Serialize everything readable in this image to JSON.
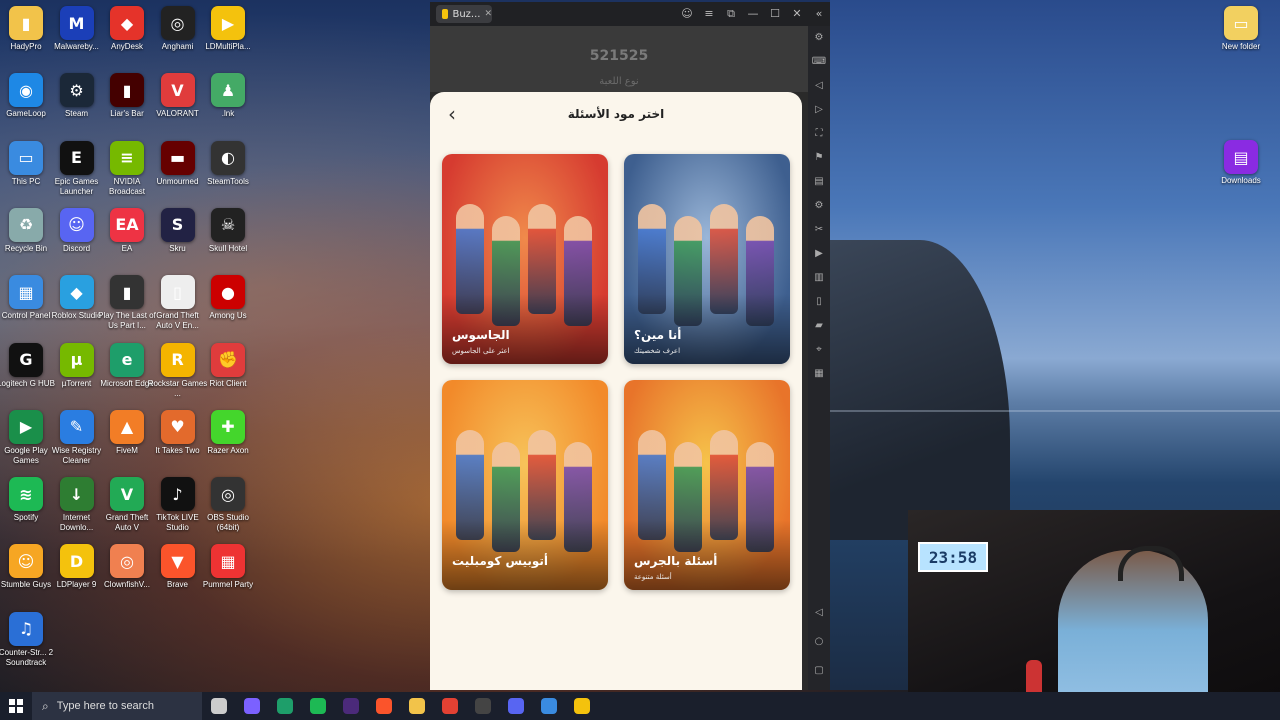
{
  "desktop": {
    "icons": [
      {
        "label": "HadyPro",
        "color": "#f2c34a",
        "glyph": "▮"
      },
      {
        "label": "Malwareby...",
        "color": "#1b3fb8",
        "glyph": "M"
      },
      {
        "label": "AnyDesk",
        "color": "#e5332a",
        "glyph": "◆"
      },
      {
        "label": "Anghami",
        "color": "#222",
        "glyph": "◎"
      },
      {
        "label": "LDMultiPla...",
        "color": "#f4c20d",
        "glyph": "▶"
      },
      {
        "label": "GameLoop",
        "color": "#1e88e5",
        "glyph": "◉"
      },
      {
        "label": "Steam",
        "color": "#1b2838",
        "glyph": "⚙"
      },
      {
        "label": "Liar's Bar",
        "color": "#400",
        "glyph": "▮"
      },
      {
        "label": "VALORANT",
        "color": "#e03c3c",
        "glyph": "V"
      },
      {
        "label": ".lnk",
        "color": "#4a6",
        "glyph": "♟"
      },
      {
        "label": "This PC",
        "color": "#3a8be0",
        "glyph": "▭"
      },
      {
        "label": "Epic Games Launcher",
        "color": "#111",
        "glyph": "E"
      },
      {
        "label": "NVIDIA Broadcast",
        "color": "#76b900",
        "glyph": "≡"
      },
      {
        "label": "Unmourned",
        "color": "#600",
        "glyph": "▬"
      },
      {
        "label": "SteamTools",
        "color": "#333",
        "glyph": "◐"
      },
      {
        "label": "Recycle Bin",
        "color": "#8aa",
        "glyph": "♻"
      },
      {
        "label": "Discord",
        "color": "#5865f2",
        "glyph": "☺"
      },
      {
        "label": "EA",
        "color": "#e34",
        "glyph": "EA"
      },
      {
        "label": "Skru",
        "color": "#224",
        "glyph": "S"
      },
      {
        "label": "Skull Hotel",
        "color": "#222",
        "glyph": "☠"
      },
      {
        "label": "Control Panel",
        "color": "#3a8be0",
        "glyph": "▦"
      },
      {
        "label": "Roblox Studio",
        "color": "#29a0e0",
        "glyph": "◆"
      },
      {
        "label": "Play The Last of Us Part I...",
        "color": "#333",
        "glyph": "▮"
      },
      {
        "label": "Grand Theft Auto V En...",
        "color": "#eee",
        "glyph": "▯"
      },
      {
        "label": "Among Us",
        "color": "#c00",
        "glyph": "●"
      },
      {
        "label": "Logitech G HUB",
        "color": "#111",
        "glyph": "G"
      },
      {
        "label": "µTorrent",
        "color": "#76b900",
        "glyph": "µ"
      },
      {
        "label": "Microsoft Edge",
        "color": "#1e9e6a",
        "glyph": "e"
      },
      {
        "label": "Rockstar Games ...",
        "color": "#f4b400",
        "glyph": "R"
      },
      {
        "label": "Riot Client",
        "color": "#e03c3c",
        "glyph": "✊"
      },
      {
        "label": "Google Play Games",
        "color": "#1a8f4a",
        "glyph": "▶"
      },
      {
        "label": "Wise Registry Cleaner",
        "color": "#2a7de1",
        "glyph": "✎"
      },
      {
        "label": "FiveM",
        "color": "#f27d26",
        "glyph": "▲"
      },
      {
        "label": "It Takes Two",
        "color": "#e36a2c",
        "glyph": "♥"
      },
      {
        "label": "Razer Axon",
        "color": "#44d62c",
        "glyph": "✚"
      },
      {
        "label": "Spotify",
        "color": "#1db954",
        "glyph": "≋"
      },
      {
        "label": "Internet Downlo...",
        "color": "#2e7d32",
        "glyph": "↓"
      },
      {
        "label": "Grand Theft Auto V",
        "color": "#2a5",
        "glyph": "V"
      },
      {
        "label": "TikTok LIVE Studio",
        "color": "#111",
        "glyph": "♪"
      },
      {
        "label": "OBS Studio (64bit)",
        "color": "#333",
        "glyph": "◎"
      },
      {
        "label": "Stumble Guys",
        "color": "#f6a623",
        "glyph": "☺"
      },
      {
        "label": "LDPlayer 9",
        "color": "#f4c20d",
        "glyph": "D"
      },
      {
        "label": "ClownfishV...",
        "color": "#f08050",
        "glyph": "◎"
      },
      {
        "label": "Brave",
        "color": "#fb542b",
        "glyph": "▼"
      },
      {
        "label": "Pummel Party",
        "color": "#e33",
        "glyph": "▦"
      },
      {
        "label": "Counter-Str... 2 Soundtrack",
        "color": "#2a6fd6",
        "glyph": "♫"
      },
      {
        "label": "New folder",
        "color": "#f2d060",
        "glyph": "▭"
      },
      {
        "label": "Downloads",
        "color": "#8a2be2",
        "glyph": "▤"
      }
    ]
  },
  "emulator": {
    "tab_label": "Buz...",
    "controls": [
      "☺",
      "≡",
      "⧉",
      "—",
      "☐",
      "✕",
      "«"
    ],
    "sidebar": [
      "⚙",
      "⌨",
      "◁",
      "▷",
      "⛶",
      "⚑",
      "▤",
      "⚙",
      "✂",
      "▶",
      "▥",
      "▯",
      "▰",
      "⌖",
      "▦"
    ],
    "nav": [
      "◁",
      "○",
      "▢"
    ],
    "background_app": {
      "code": "521525",
      "subtitle": "نوع اللعبة"
    },
    "sheet": {
      "title": "اختر مود الأسئلة",
      "back_icon": "‹",
      "cards": [
        {
          "title": "الجاسوس",
          "subtitle": "اعثر على الجاسوس",
          "palette": [
            "#d63b30",
            "#f08a4b"
          ]
        },
        {
          "title": "أنا مين؟",
          "subtitle": "اعرف شخصيتك",
          "palette": [
            "#3e5f8f",
            "#9ab6d8"
          ]
        },
        {
          "title": "أتوبيس كومبليت",
          "subtitle": "",
          "palette": [
            "#f28a2a",
            "#f7c35a"
          ]
        },
        {
          "title": "أسئلة بالجرس",
          "subtitle": "أسئلة متنوعة",
          "palette": [
            "#e8742a",
            "#f6c34b"
          ]
        }
      ]
    }
  },
  "webcam": {
    "clock": "23:58"
  },
  "taskbar": {
    "search_placeholder": "Type here to search",
    "icons": [
      {
        "name": "task-view",
        "color": "#ccc"
      },
      {
        "name": "copilot",
        "color": "#7b61ff"
      },
      {
        "name": "edge",
        "color": "#1e9e6a"
      },
      {
        "name": "spotify",
        "color": "#1db954"
      },
      {
        "name": "premiere",
        "color": "#4b2a7a"
      },
      {
        "name": "brave",
        "color": "#fb542b"
      },
      {
        "name": "explorer",
        "color": "#f2c34a"
      },
      {
        "name": "chrome",
        "color": "#e34133"
      },
      {
        "name": "obs",
        "color": "#444"
      },
      {
        "name": "discord",
        "color": "#5865f2"
      },
      {
        "name": "unknown",
        "color": "#3a8be0"
      },
      {
        "name": "ldplayer",
        "color": "#f4c20d"
      }
    ]
  }
}
